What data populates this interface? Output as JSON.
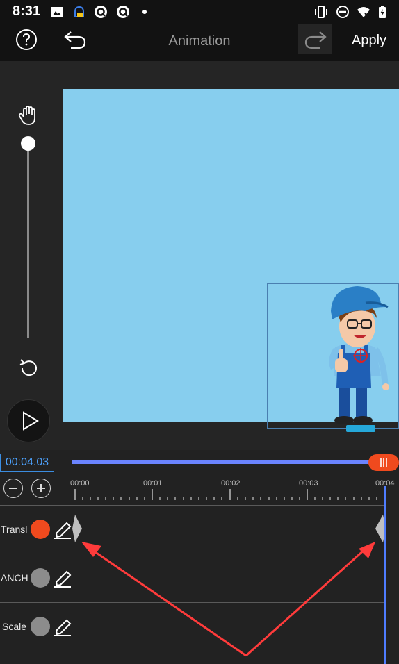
{
  "status_bar": {
    "time": "8:31",
    "left_icons": [
      "image-icon",
      "android-box-icon",
      "q-app-icon",
      "q-app-icon",
      "dot-icon"
    ],
    "right_icons": [
      "vibrate-icon",
      "dnd-icon",
      "wifi-icon",
      "battery-charging-icon"
    ]
  },
  "toolbar": {
    "title": "Animation",
    "apply_label": "Apply",
    "icons": [
      "help-icon",
      "undo-icon",
      "redo-icon"
    ]
  },
  "side_controls": {
    "icons": [
      "hand-icon",
      "reset-rotate-icon",
      "play-icon"
    ],
    "zoom_level": 0.96
  },
  "timeline": {
    "timecode": "00:04.03",
    "playhead_position_seconds": 4.03,
    "duration_seconds": 4.0,
    "ticks": [
      "00:00",
      "00:01",
      "00:02",
      "00:03",
      "00:04"
    ],
    "tracks": [
      {
        "label": "Transl",
        "active": true,
        "dot_color": "#f04a1e"
      },
      {
        "label": "ANCH",
        "active": false,
        "dot_color": "#8c8c8c"
      },
      {
        "label": "Scale",
        "active": false,
        "dot_color": "#8c8c8c"
      }
    ]
  },
  "colors": {
    "stage_background": "#87ceee",
    "accent_blue": "#4f7dff",
    "accent_orange": "#f04a1e",
    "annotation_arrow": "#ff3b3b"
  }
}
